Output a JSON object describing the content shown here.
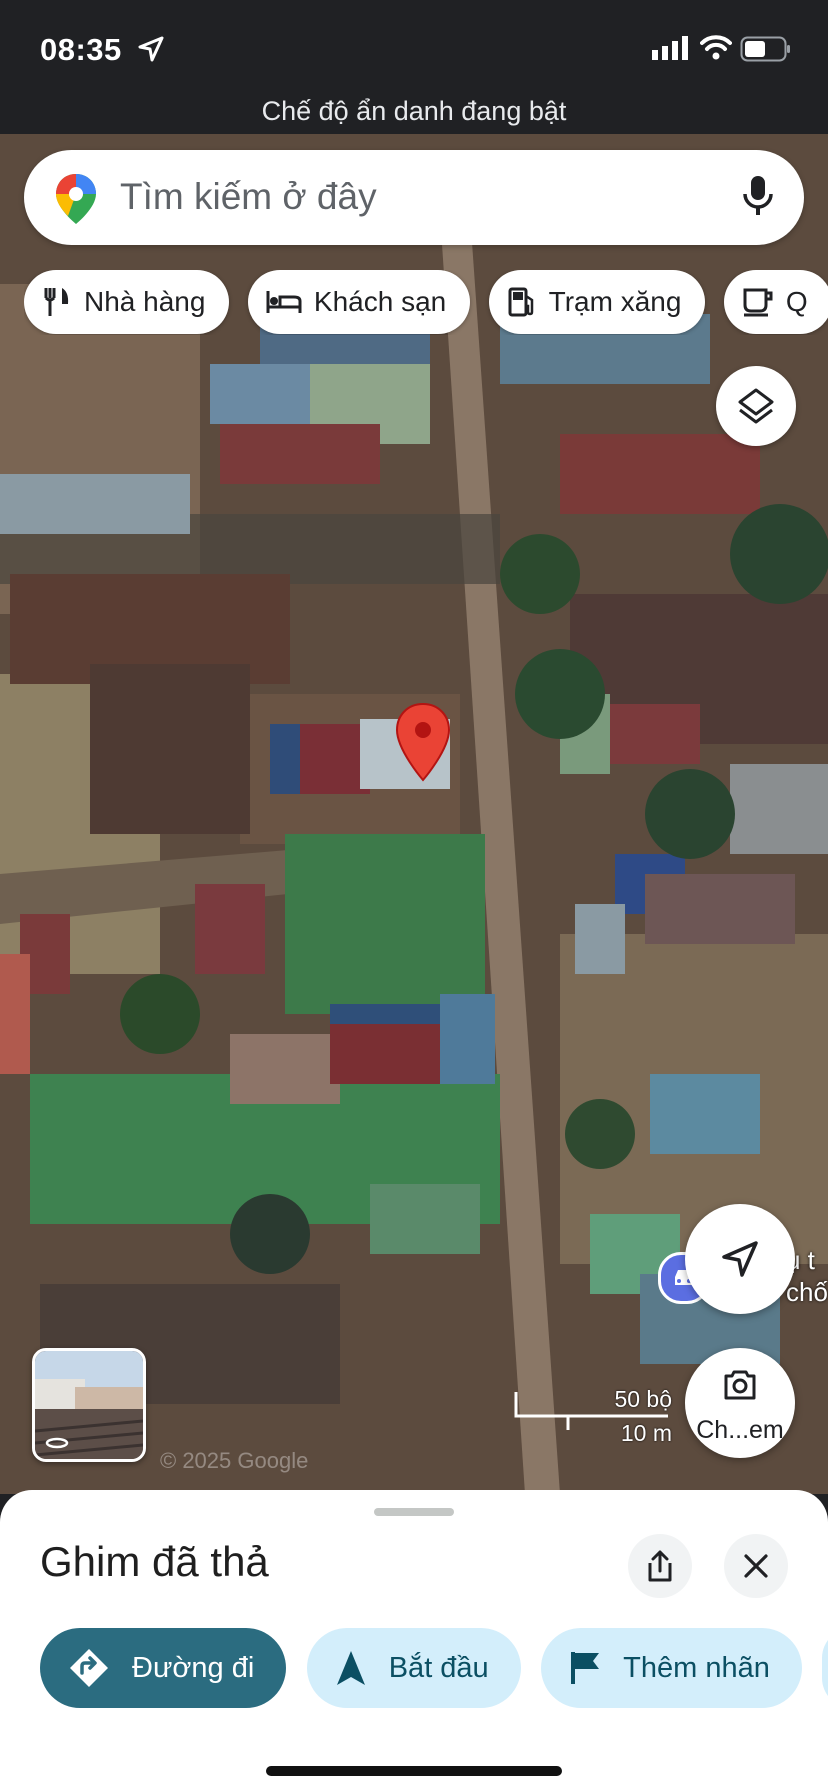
{
  "status_bar": {
    "time": "08:35",
    "incognito_text": "Chế độ ẩn danh đang bật"
  },
  "search": {
    "placeholder": "Tìm kiếm ở đây"
  },
  "chips": [
    {
      "label": "Nhà hàng",
      "icon": "restaurant-icon"
    },
    {
      "label": "Khách sạn",
      "icon": "hotel-icon"
    },
    {
      "label": "Trạm xăng",
      "icon": "gas-station-icon"
    },
    {
      "label": "Q",
      "icon": "coffee-icon"
    }
  ],
  "map": {
    "place_label_line1": "ụ t",
    "place_label_line2": "chố",
    "scale_top": "50 bộ",
    "scale_bottom": "10 m",
    "watermark": "© 2025 Google",
    "lens_label": "Ch...em",
    "pin_color": "#ea4335"
  },
  "sheet": {
    "title": "Ghim đã thả",
    "actions": [
      {
        "label": "Đường đi",
        "icon": "directions-icon",
        "style": "primary"
      },
      {
        "label": "Bắt đầu",
        "icon": "navigation-icon",
        "style": "secondary"
      },
      {
        "label": "Thêm nhãn",
        "icon": "flag-icon",
        "style": "secondary"
      }
    ]
  },
  "colors": {
    "primary_action": "#2b6c80",
    "secondary_action": "#d3eefb",
    "header": "#202124"
  }
}
